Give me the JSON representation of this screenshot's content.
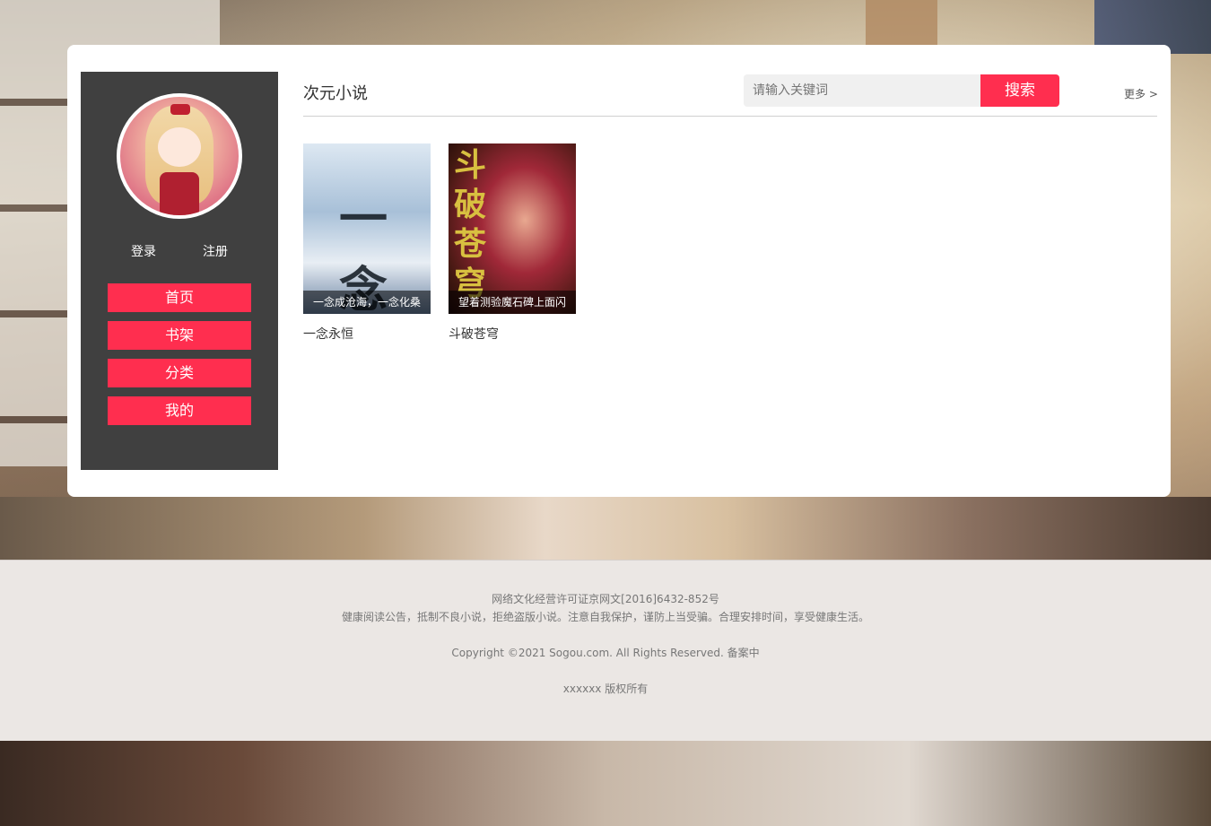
{
  "sidebar": {
    "login_label": "登录",
    "register_label": "注册",
    "nav": [
      {
        "label": "首页"
      },
      {
        "label": "书架"
      },
      {
        "label": "分类"
      },
      {
        "label": "我的"
      }
    ]
  },
  "main": {
    "title": "次元小说",
    "search": {
      "placeholder": "请输入关键词",
      "button_label": "搜索"
    },
    "more_label": "更多 >",
    "books": [
      {
        "title": "一念永恒",
        "caption": "一念成沧海，一念化桑",
        "cover_text": "一念永恒"
      },
      {
        "title": "斗破苍穹",
        "caption": "望着测验魔石碑上面闪",
        "cover_text": "斗破苍穹"
      }
    ]
  },
  "footer": {
    "license": "网络文化经营许可证京网文[2016]6432-852号",
    "notice": "健康阅读公告，抵制不良小说，拒绝盗版小说。注意自我保护，谨防上当受骗。合理安排时间，享受健康生活。",
    "copyright": "Copyright ©2021 Sogou.com. All Rights Reserved. 备案中",
    "owner": "xxxxxx 版权所有"
  },
  "colors": {
    "accent": "#ff2e4f",
    "sidebar_bg": "#404040",
    "footer_bg": "#ebe7e4"
  }
}
